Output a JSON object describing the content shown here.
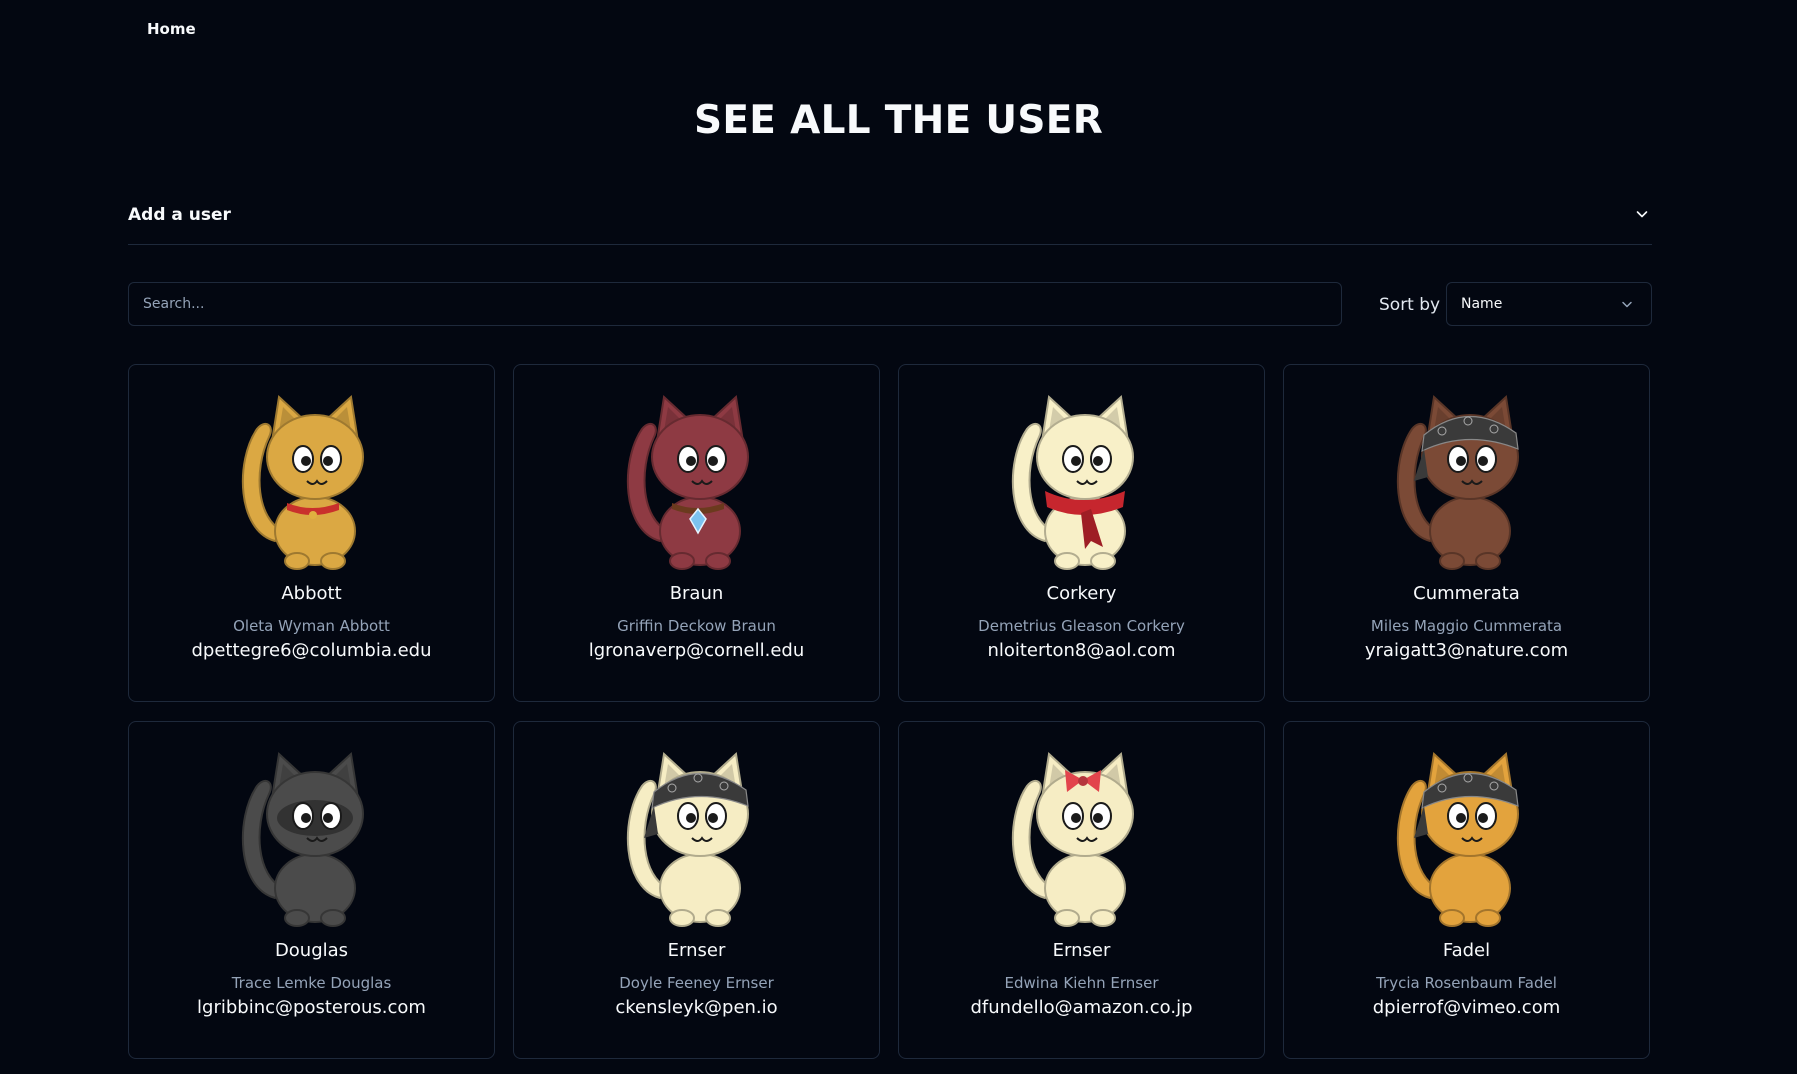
{
  "nav": {
    "home": "Home"
  },
  "page": {
    "title": "SEE ALL THE USER"
  },
  "accordion": {
    "label": "Add a user"
  },
  "search": {
    "placeholder": "Search..."
  },
  "sort": {
    "label": "Sort by",
    "selected": "Name"
  },
  "users": [
    {
      "last": "Abbott",
      "full": "Oleta Wyman Abbott",
      "email": "dpettegre6@columbia.edu",
      "color": "#dba843",
      "accessory": "collar",
      "accessory_color": "#c9302c"
    },
    {
      "last": "Braun",
      "full": "Griffin Deckow Braun",
      "email": "lgronaverp@cornell.edu",
      "color": "#8e3a43",
      "accessory": "gem-collar",
      "accessory_color": "#7cc2f0"
    },
    {
      "last": "Corkery",
      "full": "Demetrius Gleason Corkery",
      "email": "nloiterton8@aol.com",
      "color": "#f8f0c8",
      "accessory": "scarf",
      "accessory_color": "#c6262e"
    },
    {
      "last": "Cummerata",
      "full": "Miles Maggio Cummerata",
      "email": "yraigatt3@nature.com",
      "color": "#7b4a36",
      "accessory": "bandana",
      "accessory_color": "#3a3a3a"
    },
    {
      "last": "Douglas",
      "full": "Trace Lemke Douglas",
      "email": "lgribbinc@posterous.com",
      "color": "#4b4b4b",
      "accessory": "mask",
      "accessory_color": "#2a2a2a"
    },
    {
      "last": "Ernser",
      "full": "Doyle Feeney Ernser",
      "email": "ckensleyk@pen.io",
      "color": "#f6edc4",
      "accessory": "bandana",
      "accessory_color": "#3a3a3a"
    },
    {
      "last": "Ernser",
      "full": "Edwina Kiehn Ernser",
      "email": "dfundello@amazon.co.jp",
      "color": "#f6edc4",
      "accessory": "bow",
      "accessory_color": "#e2444c"
    },
    {
      "last": "Fadel",
      "full": "Trycia Rosenbaum Fadel",
      "email": "dpierrof@vimeo.com",
      "color": "#e3a33d",
      "accessory": "bandana",
      "accessory_color": "#3a3a3a"
    }
  ]
}
